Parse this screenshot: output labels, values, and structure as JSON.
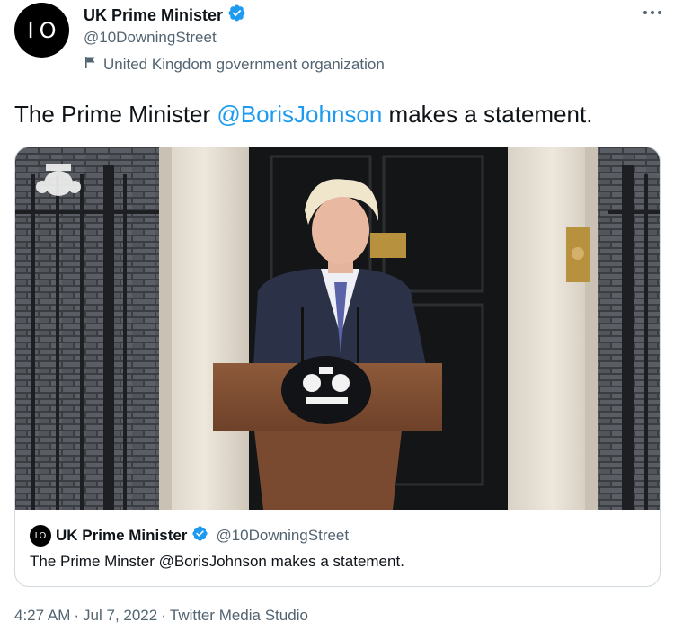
{
  "author": {
    "avatar_text": "IO",
    "display_name": "UK Prime Minister",
    "handle": "@10DowningStreet",
    "label": "United Kingdom government organization",
    "verified_icon": "verified-badge-icon",
    "label_icon": "flag-icon"
  },
  "more_icon": "more-options-icon",
  "tweet": {
    "text_before": "The Prime Minister ",
    "mention": "@BorisJohnson",
    "text_after": " makes a statement."
  },
  "quote": {
    "avatar_text": "IO",
    "display_name": "UK Prime Minister",
    "handle": "@10DowningStreet",
    "text": "The Prime Minster @BorisJohnson makes a statement."
  },
  "meta": {
    "time": "4:27 AM",
    "sep1": "·",
    "date": "Jul 7, 2022",
    "sep2": "·",
    "source": "Twitter Media Studio"
  },
  "colors": {
    "accent": "#1d9bf0",
    "text": "#0f1419",
    "muted": "#536471",
    "border": "#cfd9de"
  }
}
